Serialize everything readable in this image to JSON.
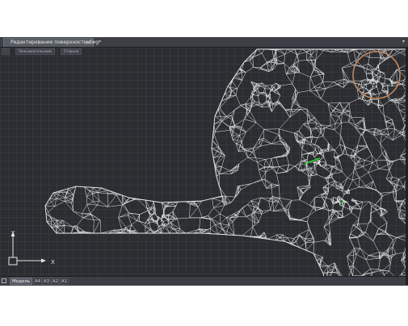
{
  "document_tab": {
    "title": "Редактирование поверхности.dwg*",
    "close_glyph": "✕"
  },
  "tab_menu_glyph": "▾",
  "viewport_controls": [
    {
      "label": "-"
    },
    {
      "label": "Пользовательский"
    },
    {
      "label": "Сторона"
    }
  ],
  "ucs": {
    "x_label": "X",
    "y_label": "Y"
  },
  "layout_tabs": [
    {
      "label": "Модель",
      "active": true
    },
    {
      "label": "A4",
      "active": false
    },
    {
      "label": "A3",
      "active": false
    },
    {
      "label": "A2",
      "active": false
    },
    {
      "label": "A1",
      "active": false
    }
  ],
  "colors": {
    "canvas": "#2b2d31",
    "mesh_lines": "#e9e9e9",
    "circle_marker": "#c4875a",
    "cursor_marker": "#2fd12f"
  },
  "icons": {
    "layout_toggle": "square-icon",
    "ucs": "ucs-axes-icon"
  }
}
